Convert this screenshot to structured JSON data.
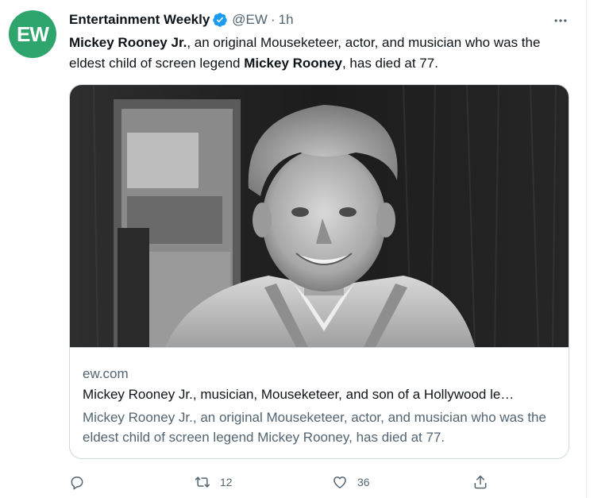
{
  "tweet": {
    "avatar_text": "EW",
    "author_name": "Entertainment Weekly",
    "handle": "@EW",
    "separator": "·",
    "time": "1h",
    "text_part1": "Mickey Rooney Jr.",
    "text_part2": ", an original Mouseketeer, actor, and musician who was the eldest child of screen legend ",
    "text_part3": "Mickey Rooney",
    "text_part4": ", has died at 77."
  },
  "card": {
    "domain": "ew.com",
    "title": "Mickey Rooney Jr., musician, Mouseketeer, and son of a Hollywood le…",
    "description": "Mickey Rooney Jr., an original Mouseketeer, actor, and musician who was the eldest child of screen legend Mickey Rooney, has died at 77."
  },
  "actions": {
    "reply_count": "",
    "retweet_count": "12",
    "like_count": "36"
  },
  "icons": {
    "avatar_logo": "ew-logo",
    "verified": "verified-badge-icon",
    "more": "more-icon",
    "reply": "reply-icon",
    "retweet": "retweet-icon",
    "like": "heart-icon",
    "share": "share-icon"
  },
  "colors": {
    "avatar_bg": "#2fa56e",
    "verified_blue": "#1d9bf0",
    "secondary_text": "#536471",
    "primary_text": "#0f1419",
    "border": "#cfd9de"
  }
}
